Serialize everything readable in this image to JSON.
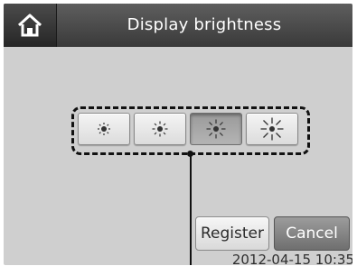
{
  "header": {
    "title": "Display brightness",
    "home_icon": "home-icon"
  },
  "brightness": {
    "levels": [
      {
        "icon": "sun-icon"
      },
      {
        "icon": "sun-icon"
      },
      {
        "icon": "sun-icon"
      },
      {
        "icon": "sun-icon"
      }
    ],
    "selected_level": 3
  },
  "actions": {
    "register_label": "Register",
    "cancel_label": "Cancel"
  },
  "status": {
    "datetime": "2012-04-15 10:35"
  }
}
